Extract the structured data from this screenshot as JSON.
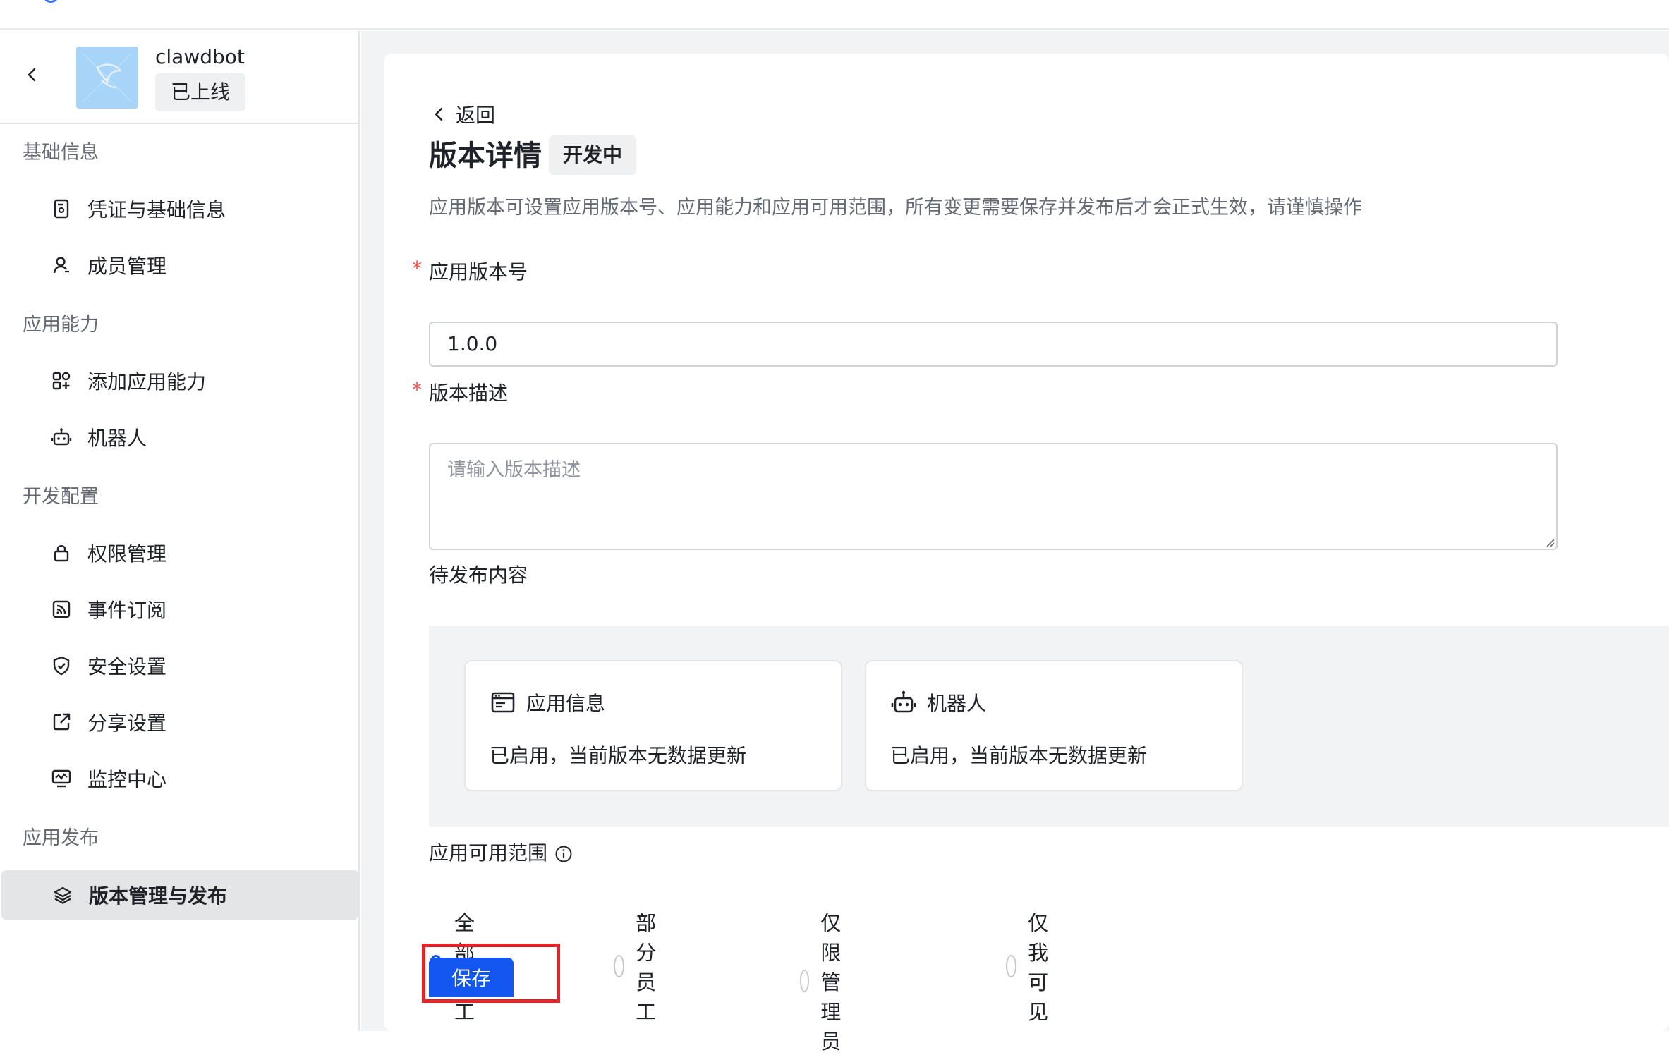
{
  "sidebar": {
    "app": {
      "name": "clawdbot",
      "status": "已上线"
    },
    "groups": [
      {
        "title": "基础信息",
        "items": [
          {
            "label": "凭证与基础信息",
            "icon": "credential-icon"
          },
          {
            "label": "成员管理",
            "icon": "user-icon"
          }
        ]
      },
      {
        "title": "应用能力",
        "items": [
          {
            "label": "添加应用能力",
            "icon": "apps-add-icon"
          },
          {
            "label": "机器人",
            "icon": "robot-icon"
          }
        ]
      },
      {
        "title": "开发配置",
        "items": [
          {
            "label": "权限管理",
            "icon": "lock-icon"
          },
          {
            "label": "事件订阅",
            "icon": "rss-icon"
          },
          {
            "label": "安全设置",
            "icon": "shield-icon"
          },
          {
            "label": "分享设置",
            "icon": "share-icon"
          },
          {
            "label": "监控中心",
            "icon": "monitor-icon"
          }
        ]
      },
      {
        "title": "应用发布",
        "items": [
          {
            "label": "版本管理与发布",
            "icon": "layers-icon",
            "active": true
          }
        ]
      }
    ]
  },
  "main": {
    "back_label": "返回",
    "title": "版本详情",
    "title_tag": "开发中",
    "description": "应用版本可设置应用版本号、应用能力和应用可用范围，所有变更需要保存并发布后才会正式生效，请谨慎操作",
    "version_field": {
      "label": "应用版本号",
      "value": "1.0.0",
      "required_mark": "*"
    },
    "desc_field": {
      "label": "版本描述",
      "placeholder": "请输入版本描述",
      "required_mark": "*"
    },
    "pending": {
      "label": "待发布内容",
      "cards": [
        {
          "title": "应用信息",
          "status": "已启用，当前版本无数据更新",
          "icon": "window-icon"
        },
        {
          "title": "机器人",
          "status": "已启用，当前版本无数据更新",
          "icon": "robot-icon"
        }
      ]
    },
    "scope": {
      "label": "应用可用范围",
      "options": [
        "全部员工",
        "部分员工",
        "仅限管理员",
        "仅我可见"
      ],
      "selected": "全部员工"
    },
    "save_label": "保存"
  },
  "colors": {
    "primary": "#1456f0",
    "required": "#f54a45",
    "highlight": "#e0262a"
  }
}
